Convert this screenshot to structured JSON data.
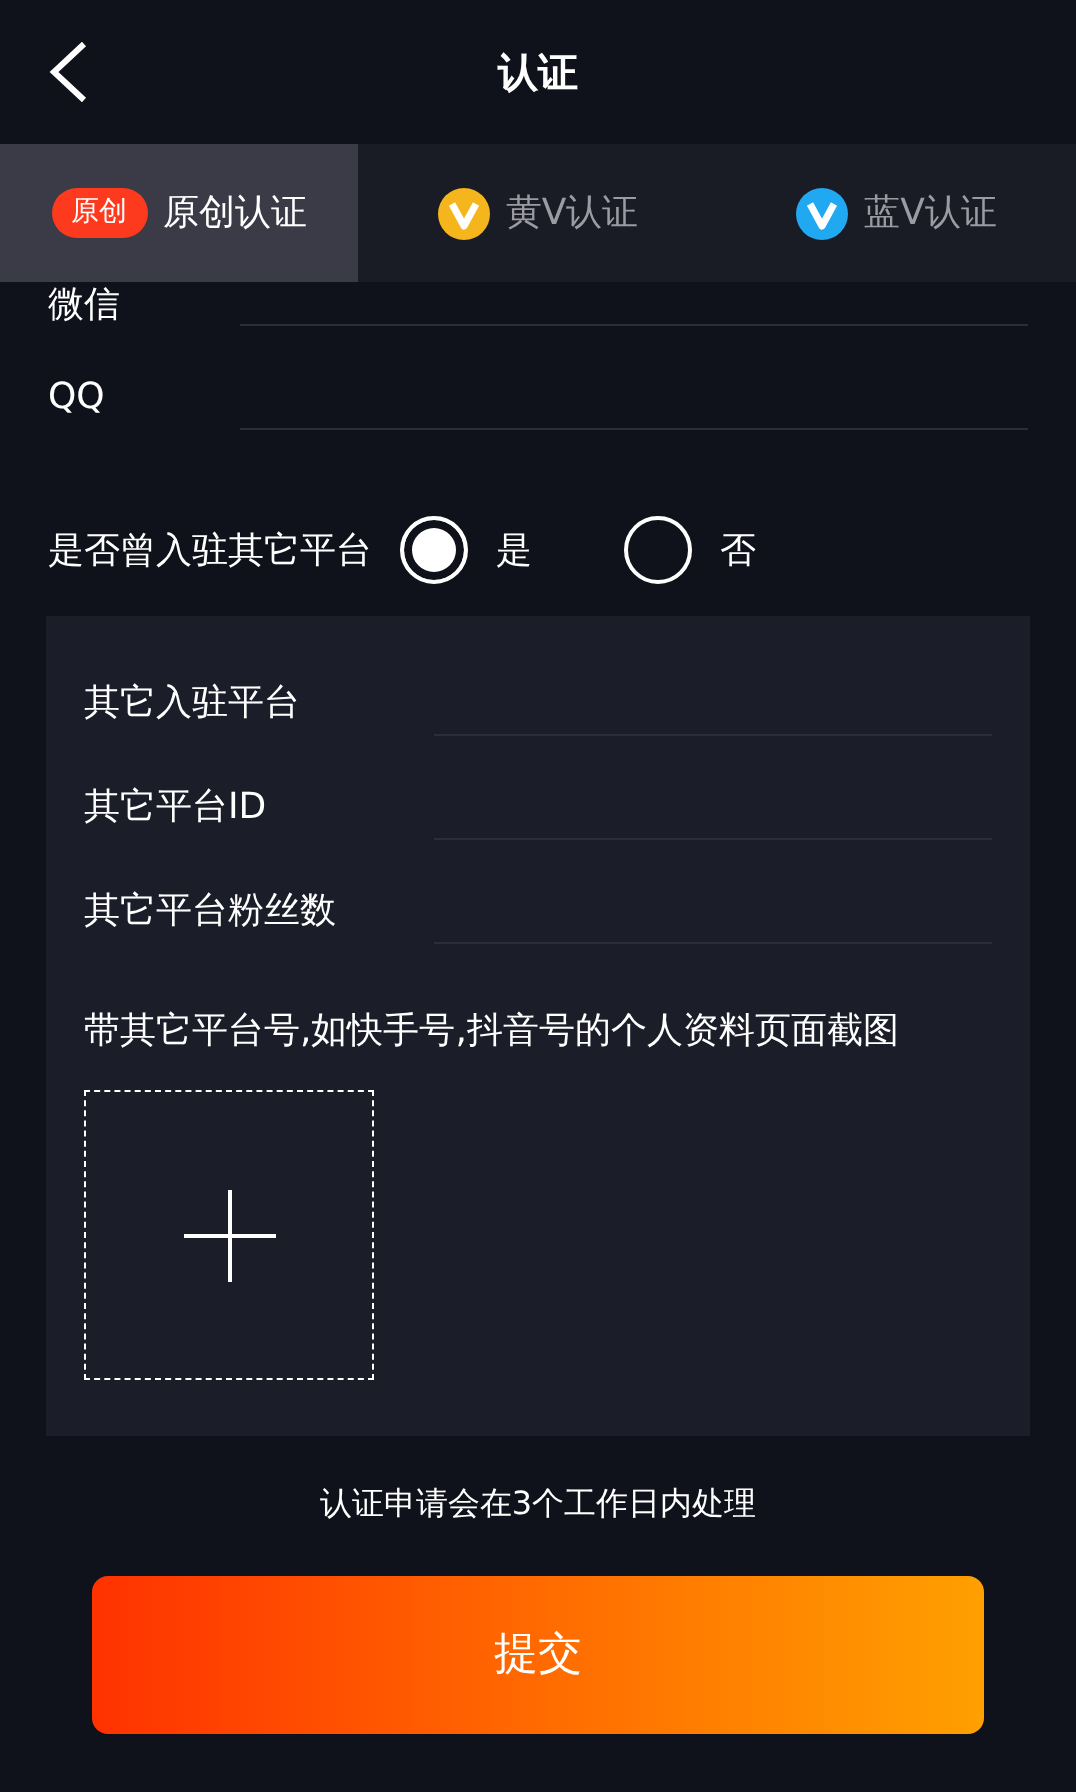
{
  "header": {
    "title": "认证"
  },
  "tabs": [
    {
      "kind": "badge",
      "badge": "原创",
      "label": "原创认证",
      "selected": true
    },
    {
      "kind": "v-icon",
      "color": "#f5b51c",
      "label": "黄V认证",
      "selected": false
    },
    {
      "kind": "v-icon",
      "color": "#20a8f0",
      "label": "蓝V认证",
      "selected": false
    }
  ],
  "fields": [
    {
      "label": "微信"
    },
    {
      "label": "QQ"
    }
  ],
  "question": {
    "label": "是否曾入驻其它平台",
    "options": [
      {
        "label": "是",
        "selected": true
      },
      {
        "label": "否",
        "selected": false
      }
    ]
  },
  "panel": {
    "fields": [
      {
        "label": "其它入驻平台"
      },
      {
        "label": "其它平台ID"
      },
      {
        "label": "其它平台粉丝数"
      }
    ],
    "upload_hint": "带其它平台号,如快手号,抖音号的个人资料页面截图"
  },
  "notice": "认证申请会在3个工作日内处理",
  "submit": "提交"
}
